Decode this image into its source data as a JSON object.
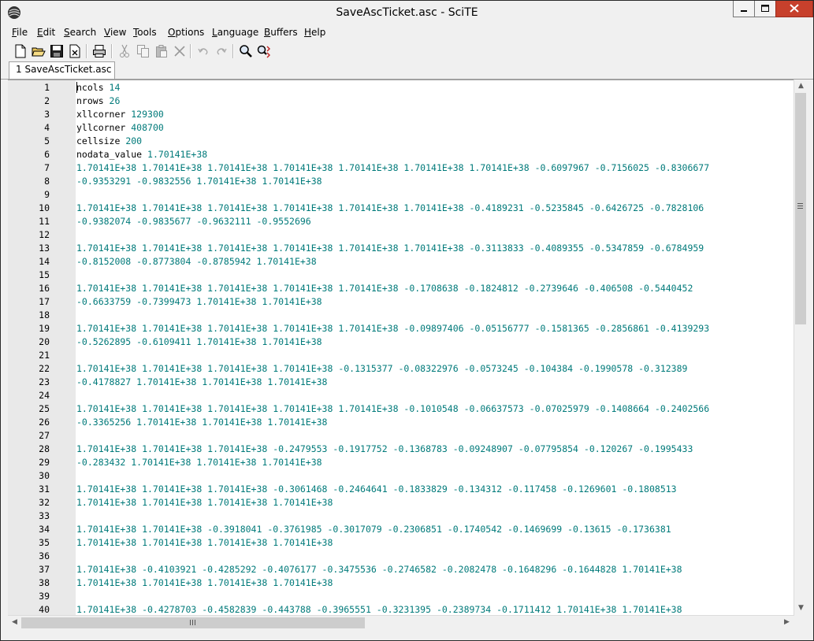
{
  "window": {
    "title": "SaveAscTicket.asc - SciTE",
    "minimize_icon": "minimize-icon",
    "maximize_icon": "maximize-icon",
    "close_icon": "close-icon"
  },
  "menu": [
    {
      "label": "File"
    },
    {
      "label": "Edit"
    },
    {
      "label": "Search"
    },
    {
      "label": "View"
    },
    {
      "label": "Tools"
    },
    {
      "label": "Options"
    },
    {
      "label": "Language"
    },
    {
      "label": "Buffers"
    },
    {
      "label": "Help"
    }
  ],
  "toolbar": [
    {
      "icon": "new-file-icon"
    },
    {
      "icon": "open-folder-icon"
    },
    {
      "icon": "save-icon"
    },
    {
      "icon": "close-file-icon"
    },
    {
      "icon": "print-icon"
    },
    {
      "icon": "cut-icon"
    },
    {
      "icon": "copy-icon"
    },
    {
      "icon": "paste-icon"
    },
    {
      "icon": "delete-icon"
    },
    {
      "icon": "undo-icon"
    },
    {
      "icon": "redo-icon"
    },
    {
      "icon": "find-icon"
    },
    {
      "icon": "replace-icon"
    }
  ],
  "tab": {
    "label": "1 SaveAscTicket.asc"
  },
  "colors": {
    "number": "#007a7a",
    "margin": "#e9e9e9",
    "close_button": "#c7402c"
  },
  "editor_lines": [
    {
      "num": "1",
      "key": "ncols ",
      "value": "14"
    },
    {
      "num": "2",
      "key": "nrows ",
      "value": "26"
    },
    {
      "num": "3",
      "key": "xllcorner ",
      "value": "129300"
    },
    {
      "num": "4",
      "key": "yllcorner ",
      "value": "408700"
    },
    {
      "num": "5",
      "key": "cellsize ",
      "value": "200"
    },
    {
      "num": "6",
      "key": "nodata_value ",
      "value": "1.70141E+38"
    },
    {
      "num": "7",
      "key": "",
      "value": "1.70141E+38 1.70141E+38 1.70141E+38 1.70141E+38 1.70141E+38 1.70141E+38 1.70141E+38 -0.6097967 -0.7156025 -0.8306677"
    },
    {
      "num": "8",
      "key": "",
      "value": "-0.9353291 -0.9832556 1.70141E+38 1.70141E+38"
    },
    {
      "num": "9",
      "key": "",
      "value": ""
    },
    {
      "num": "10",
      "key": "",
      "value": "1.70141E+38 1.70141E+38 1.70141E+38 1.70141E+38 1.70141E+38 1.70141E+38 -0.4189231 -0.5235845 -0.6426725 -0.7828106"
    },
    {
      "num": "11",
      "key": "",
      "value": "-0.9382074 -0.9835677 -0.9632111 -0.9552696"
    },
    {
      "num": "12",
      "key": "",
      "value": ""
    },
    {
      "num": "13",
      "key": "",
      "value": "1.70141E+38 1.70141E+38 1.70141E+38 1.70141E+38 1.70141E+38 1.70141E+38 -0.3113833 -0.4089355 -0.5347859 -0.6784959"
    },
    {
      "num": "14",
      "key": "",
      "value": "-0.8152008 -0.8773804 -0.8785942 1.70141E+38"
    },
    {
      "num": "15",
      "key": "",
      "value": ""
    },
    {
      "num": "16",
      "key": "",
      "value": "1.70141E+38 1.70141E+38 1.70141E+38 1.70141E+38 1.70141E+38 -0.1708638 -0.1824812 -0.2739646 -0.406508 -0.5440452"
    },
    {
      "num": "17",
      "key": "",
      "value": "-0.6633759 -0.7399473 1.70141E+38 1.70141E+38"
    },
    {
      "num": "18",
      "key": "",
      "value": ""
    },
    {
      "num": "19",
      "key": "",
      "value": "1.70141E+38 1.70141E+38 1.70141E+38 1.70141E+38 1.70141E+38 -0.09897406 -0.05156777 -0.1581365 -0.2856861 -0.4139293"
    },
    {
      "num": "20",
      "key": "",
      "value": "-0.5262895 -0.6109411 1.70141E+38 1.70141E+38"
    },
    {
      "num": "21",
      "key": "",
      "value": ""
    },
    {
      "num": "22",
      "key": "",
      "value": "1.70141E+38 1.70141E+38 1.70141E+38 1.70141E+38 -0.1315377 -0.08322976 -0.0573245 -0.104384 -0.1990578 -0.312389"
    },
    {
      "num": "23",
      "key": "",
      "value": "-0.4178827 1.70141E+38 1.70141E+38 1.70141E+38"
    },
    {
      "num": "24",
      "key": "",
      "value": ""
    },
    {
      "num": "25",
      "key": "",
      "value": "1.70141E+38 1.70141E+38 1.70141E+38 1.70141E+38 1.70141E+38 -0.1010548 -0.06637573 -0.07025979 -0.1408664 -0.2402566"
    },
    {
      "num": "26",
      "key": "",
      "value": "-0.3365256 1.70141E+38 1.70141E+38 1.70141E+38"
    },
    {
      "num": "27",
      "key": "",
      "value": ""
    },
    {
      "num": "28",
      "key": "",
      "value": "1.70141E+38 1.70141E+38 1.70141E+38 -0.2479553 -0.1917752 -0.1368783 -0.09248907 -0.07795854 -0.120267 -0.1995433"
    },
    {
      "num": "29",
      "key": "",
      "value": "-0.283432 1.70141E+38 1.70141E+38 1.70141E+38"
    },
    {
      "num": "30",
      "key": "",
      "value": ""
    },
    {
      "num": "31",
      "key": "",
      "value": "1.70141E+38 1.70141E+38 1.70141E+38 -0.3061468 -0.2464641 -0.1833829 -0.134312 -0.117458 -0.1269601 -0.1808513"
    },
    {
      "num": "32",
      "key": "",
      "value": "1.70141E+38 1.70141E+38 1.70141E+38 1.70141E+38"
    },
    {
      "num": "33",
      "key": "",
      "value": ""
    },
    {
      "num": "34",
      "key": "",
      "value": "1.70141E+38 1.70141E+38 -0.3918041 -0.3761985 -0.3017079 -0.2306851 -0.1740542 -0.1469699 -0.13615 -0.1736381"
    },
    {
      "num": "35",
      "key": "",
      "value": "1.70141E+38 1.70141E+38 1.70141E+38 1.70141E+38"
    },
    {
      "num": "36",
      "key": "",
      "value": ""
    },
    {
      "num": "37",
      "key": "",
      "value": "1.70141E+38 -0.4103921 -0.4285292 -0.4076177 -0.3475536 -0.2746582 -0.2082478 -0.1648296 -0.1644828 1.70141E+38"
    },
    {
      "num": "38",
      "key": "",
      "value": "1.70141E+38 1.70141E+38 1.70141E+38 1.70141E+38"
    },
    {
      "num": "39",
      "key": "",
      "value": ""
    },
    {
      "num": "40",
      "key": "",
      "value": "1.70141E+38 -0.4278703 -0.4582839 -0.443788 -0.3965551 -0.3231395 -0.2389734 -0.1711412 1.70141E+38 1.70141E+38"
    }
  ],
  "scrollbars": {
    "up_icon": "scroll-up-icon",
    "down_icon": "scroll-down-icon",
    "left_icon": "scroll-left-icon",
    "right_icon": "scroll-right-icon"
  }
}
